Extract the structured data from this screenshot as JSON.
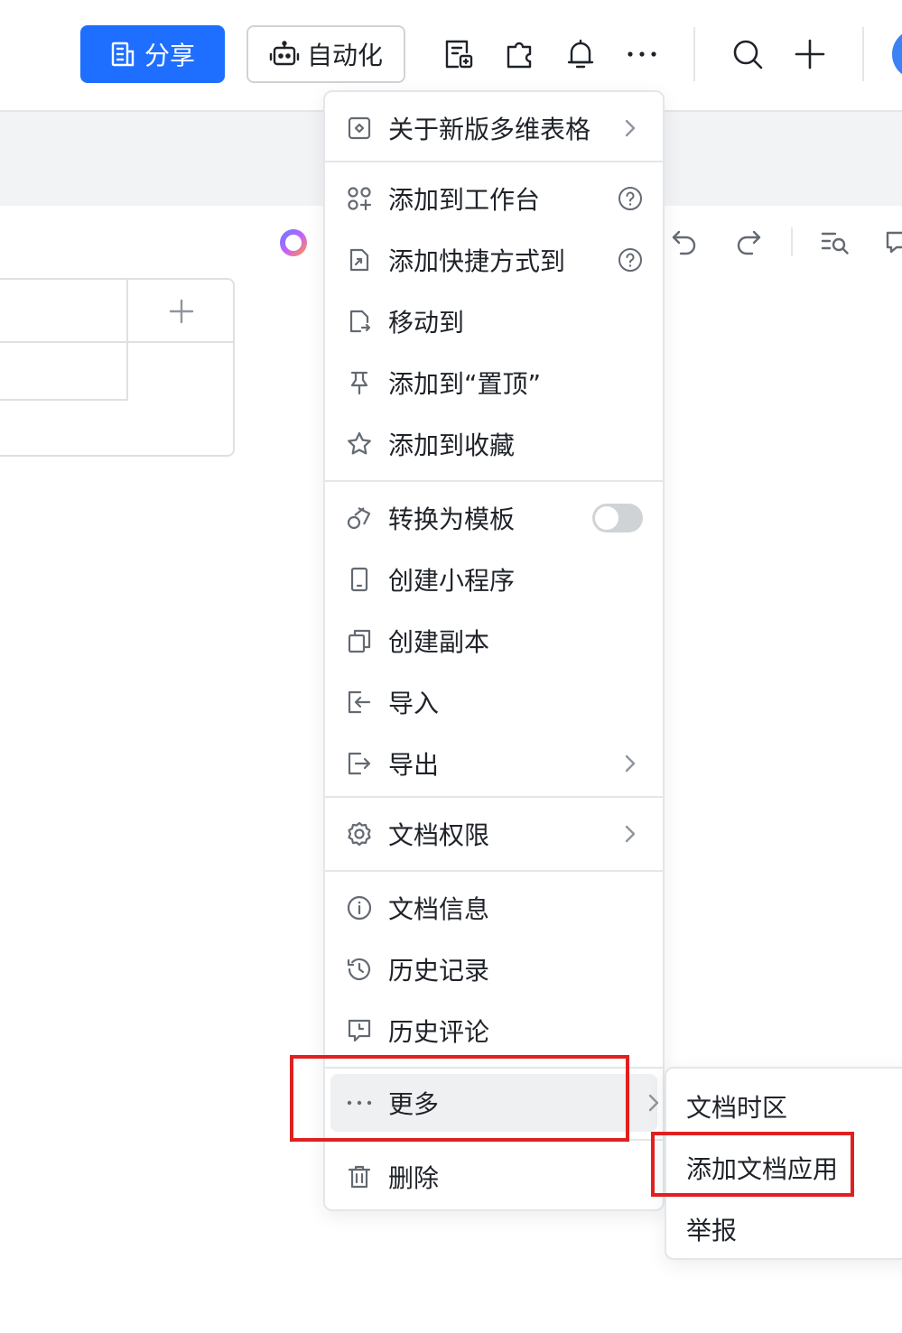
{
  "header": {
    "share_label": "分享",
    "automation_label": "自动化"
  },
  "menu": {
    "about_label": "关于新版多维表格",
    "add_workspace_label": "添加到工作台",
    "add_shortcut_label": "添加快捷方式到",
    "move_to_label": "移动到",
    "pin_label": "添加到“置顶”",
    "favorite_label": "添加到收藏",
    "convert_template_label": "转换为模板",
    "create_miniapp_label": "创建小程序",
    "create_copy_label": "创建副本",
    "import_label": "导入",
    "export_label": "导出",
    "permissions_label": "文档权限",
    "doc_info_label": "文档信息",
    "history_label": "历史记录",
    "history_comments_label": "历史评论",
    "more_label": "更多",
    "delete_label": "删除"
  },
  "submenu": {
    "timezone_label": "文档时区",
    "add_app_label": "添加文档应用",
    "report_label": "举报"
  },
  "state": {
    "convert_template_toggle": "off"
  },
  "colors": {
    "primary": "#1e6fff",
    "highlight": "#e02020"
  }
}
